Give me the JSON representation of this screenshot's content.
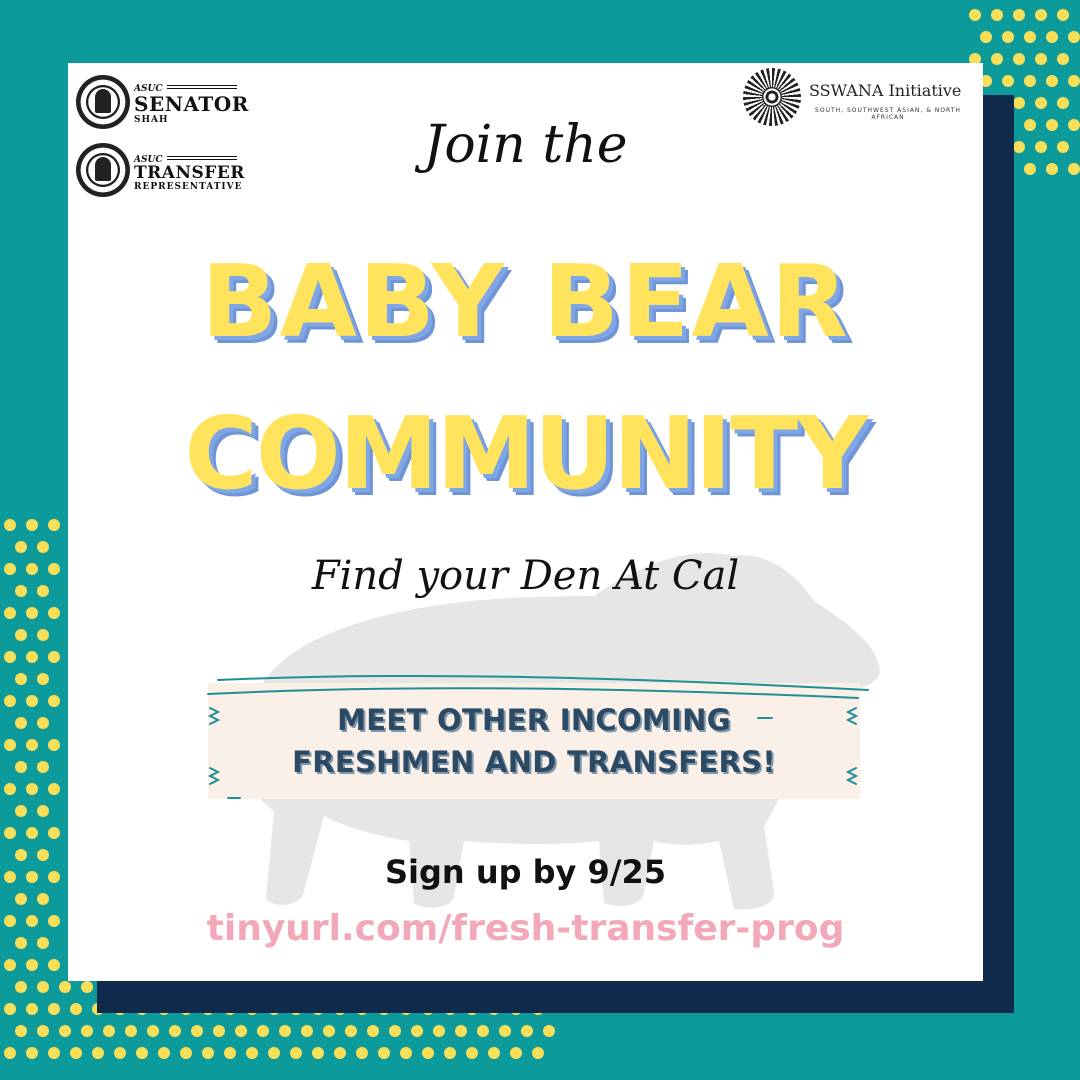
{
  "colors": {
    "background_teal": "#0d9a9b",
    "navy_frame": "#0f2a4a",
    "card_white": "#ffffff",
    "dot_yellow": "#f7df5a",
    "headline_yellow": "#ffe35c",
    "headline_shadow_blue": "#7fa6e6",
    "banner_bg": "#fbf0e8",
    "banner_text": "#2c4a63",
    "link_pink": "#f2a8b8"
  },
  "logos": {
    "senator": {
      "org": "ASUC",
      "title": "SENATOR",
      "name": "SHAH"
    },
    "transfer": {
      "org": "ASUC",
      "title": "TRANSFER",
      "subtitle": "REPRESENTATIVE"
    },
    "sswana": {
      "title": "SSWANA Initiative",
      "subtitle": "SOUTH, SOUTHWEST ASIAN, & NORTH AFRICAN"
    }
  },
  "intro": "Join the",
  "headline_line1": "BABY BEAR",
  "headline_line2": "COMMUNITY",
  "tagline": "Find your Den At Cal",
  "banner": {
    "line1": "MEET OTHER INCOMING",
    "line2": "FRESHMEN AND TRANSFERS!"
  },
  "signup": "Sign up by 9/25",
  "link": "tinyurl.com/fresh-transfer-prog",
  "icons": [
    "seal-icon",
    "mandala-icon",
    "bear-silhouette-icon"
  ]
}
